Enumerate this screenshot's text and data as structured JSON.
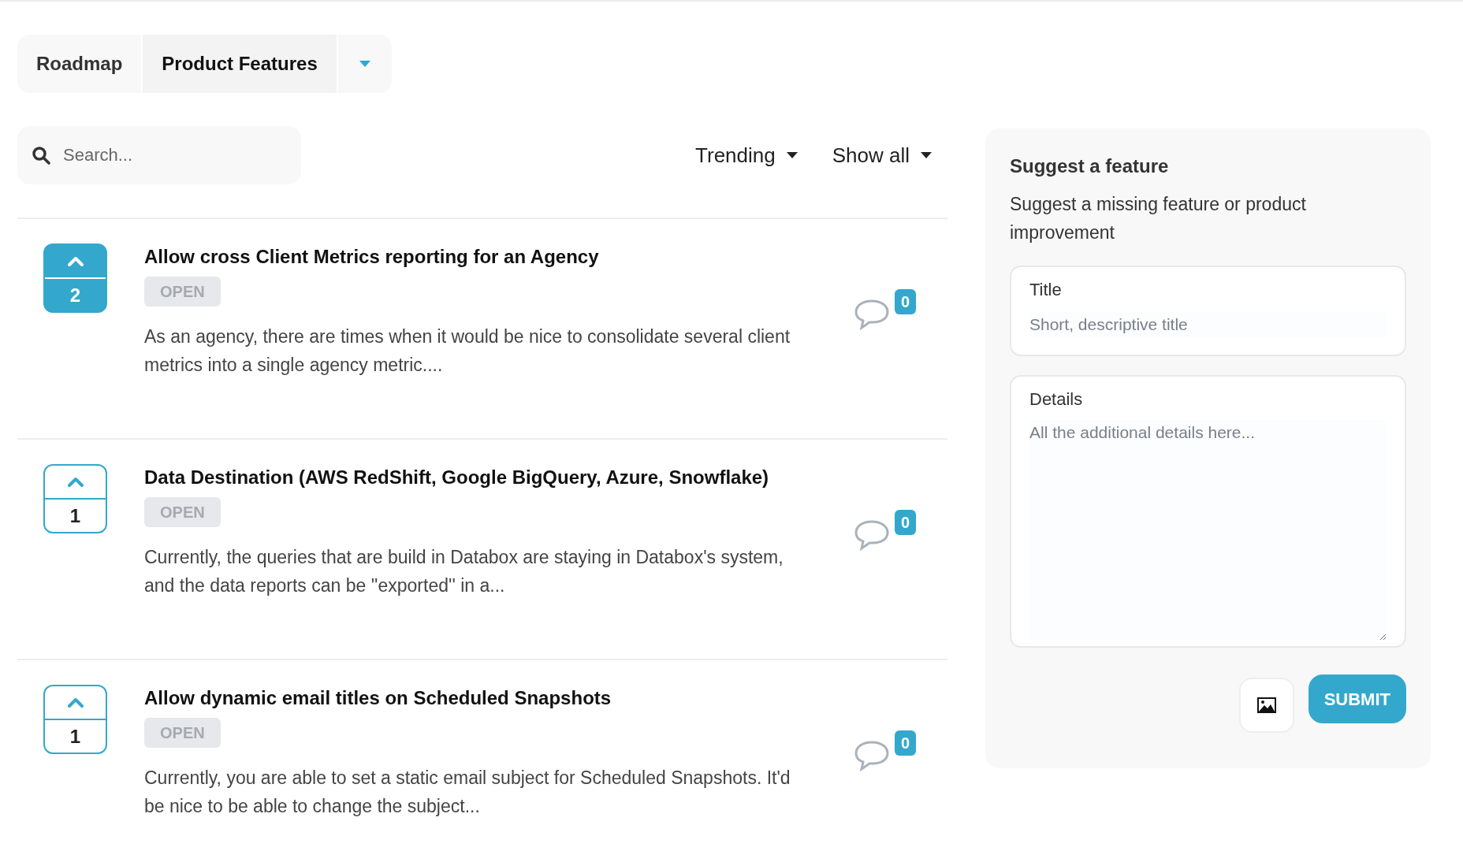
{
  "tabs": [
    {
      "label": "Roadmap",
      "selected": false
    },
    {
      "label": "Product Features",
      "selected": true
    }
  ],
  "search": {
    "placeholder": "Search..."
  },
  "filters": [
    "Trending",
    "Show all"
  ],
  "posts": [
    {
      "votes": "2",
      "voted": true,
      "title": "Allow cross Client Metrics reporting for an Agency",
      "status": "OPEN",
      "excerpt": "As an agency, there are times when it would be nice to consolidate several client metrics into a single agency metric....",
      "comments": "0"
    },
    {
      "votes": "1",
      "voted": false,
      "title": "Data Destination (AWS RedShift, Google BigQuery, Azure, Snowflake)",
      "status": "OPEN",
      "excerpt": "Currently, the queries that are build in Databox are staying in Databox's system, and the data reports can be ''exported'' in a...",
      "comments": "0"
    },
    {
      "votes": "1",
      "voted": false,
      "title": "Allow dynamic email titles on Scheduled Snapshots",
      "status": "OPEN",
      "excerpt": "Currently, you are able to set a static email subject for Scheduled Snapshots. It'd be nice to be able to change the subject...",
      "comments": "0"
    }
  ],
  "suggest": {
    "heading": "Suggest a feature",
    "description": "Suggest a missing feature or product improvement",
    "title_label": "Title",
    "title_placeholder": "Short, descriptive title",
    "details_label": "Details",
    "details_placeholder": "All the additional details here...",
    "submit": "SUBMIT"
  }
}
